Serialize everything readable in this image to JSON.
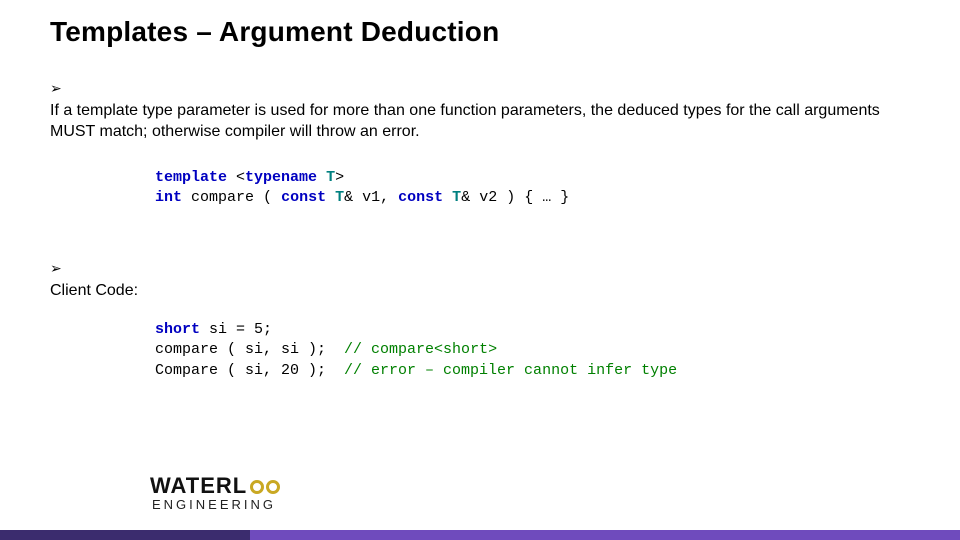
{
  "title": "Templates – Argument Deduction",
  "bullets": {
    "b1": "If a template type parameter is used for more than one function parameters, the deduced types for the call arguments MUST match; otherwise compiler will throw an error.",
    "b2": "Client Code:"
  },
  "code1": {
    "kw_template": "template",
    "lt": "<",
    "kw_typename": "typename",
    "T": "T",
    "gt": ">",
    "kw_int": "int",
    "fn": "compare",
    "open": " ( ",
    "kw_const1": "const",
    "Tref1": "T",
    "amp1": "&",
    "v1": " v1, ",
    "kw_const2": "const",
    "Tref2": "T",
    "amp2": "&",
    "v2": " v2 ",
    "close": ") { … }"
  },
  "code2": {
    "kw_short": "short",
    "decl": " si = 5;",
    "line2a": "compare ( si, si );  ",
    "cmt2slashes": "// ",
    "cmt2rest": "compare<short>",
    "line3a": "Compare ( si, 20 );  ",
    "cmt3": "// error – compiler cannot infer type"
  },
  "logo": {
    "pre": "WATERL",
    "post": "",
    "sub": "ENGINEERING"
  }
}
